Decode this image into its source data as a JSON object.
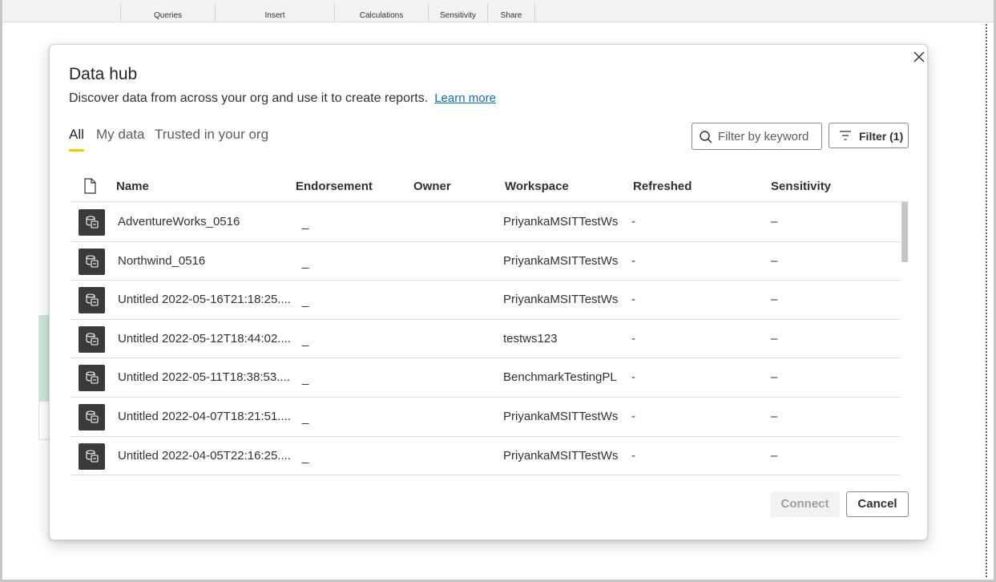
{
  "ribbon": {
    "groups": [
      "Queries",
      "Insert",
      "Calculations",
      "Sensitivity",
      "Share"
    ]
  },
  "dialog": {
    "title": "Data hub",
    "subtitle": "Discover data from across your org and use it to create reports.",
    "learn_more": "Learn more",
    "tabs": [
      "All",
      "My data",
      "Trusted in your org"
    ],
    "active_tab": "All",
    "search": {
      "placeholder": "Filter by keyword",
      "value": ""
    },
    "filter_label": "Filter (1)",
    "columns": [
      "Name",
      "Endorsement",
      "Owner",
      "Workspace",
      "Refreshed",
      "Sensitivity"
    ],
    "rows": [
      {
        "name": "AdventureWorks_0516",
        "endorsement": "_",
        "owner": "",
        "workspace": "PriyankaMSITTestWs",
        "refreshed": "-",
        "sensitivity": "–"
      },
      {
        "name": "Northwind_0516",
        "endorsement": "_",
        "owner": "",
        "workspace": "PriyankaMSITTestWs",
        "refreshed": "-",
        "sensitivity": "–"
      },
      {
        "name": "Untitled 2022-05-16T21:18:25....",
        "endorsement": "_",
        "owner": "",
        "workspace": "PriyankaMSITTestWs",
        "refreshed": "-",
        "sensitivity": "–"
      },
      {
        "name": "Untitled 2022-05-12T18:44:02....",
        "endorsement": "_",
        "owner": "",
        "workspace": "testws123",
        "refreshed": "-",
        "sensitivity": "–"
      },
      {
        "name": "Untitled 2022-05-11T18:38:53....",
        "endorsement": "_",
        "owner": "",
        "workspace": "BenchmarkTestingPL",
        "refreshed": "-",
        "sensitivity": "–"
      },
      {
        "name": "Untitled 2022-04-07T18:21:51....",
        "endorsement": "_",
        "owner": "",
        "workspace": "PriyankaMSITTestWs",
        "refreshed": "-",
        "sensitivity": "–"
      },
      {
        "name": "Untitled 2022-04-05T22:16:25....",
        "endorsement": "_",
        "owner": "",
        "workspace": "PriyankaMSITTestWs",
        "refreshed": "-",
        "sensitivity": "–"
      }
    ],
    "connect_label": "Connect",
    "cancel_label": "Cancel"
  },
  "colors": {
    "accent_tab": "#f2c811",
    "link": "#0f6cbd",
    "row_icon_bg": "#3b3a39"
  },
  "icons": {
    "close": "close-icon",
    "search": "search-icon",
    "filter": "filter-icon",
    "file": "document-icon",
    "dataset": "dataset-icon"
  }
}
